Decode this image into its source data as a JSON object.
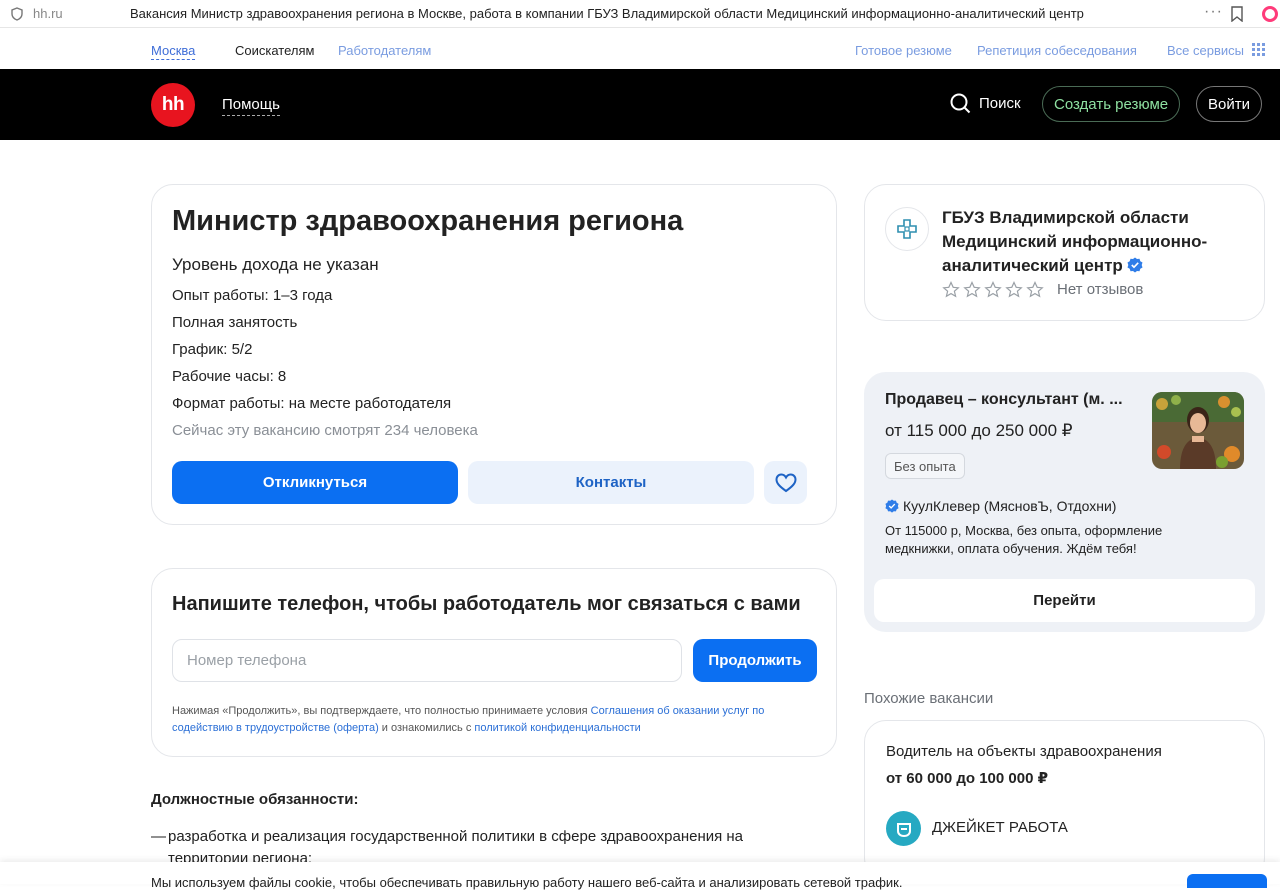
{
  "browser": {
    "url": "hh.ru",
    "tab_title": "Вакансия Министр здравоохранения региона в Москве, работа в компании ГБУЗ Владимирской области Медицинский информационно-аналитический центр"
  },
  "subnav": {
    "city": "Москва",
    "seekers": "Соискателям",
    "employers": "Работодателям",
    "ready_resume": "Готовое резюме",
    "interview_rehearsal": "Репетиция собеседования",
    "all_services": "Все сервисы"
  },
  "header": {
    "logo": "hh",
    "help": "Помощь",
    "search": "Поиск",
    "create_resume": "Создать резюме",
    "login": "Войти"
  },
  "vacancy": {
    "title": "Министр здравоохранения региона",
    "salary": "Уровень дохода не указан",
    "experience": "Опыт работы: 1–3 года",
    "employment": "Полная занятость",
    "schedule": "График: 5/2",
    "hours": "Рабочие часы: 8",
    "format": "Формат работы: на месте работодателя",
    "viewing_now": "Сейчас эту вакансию смотрят 234 человека",
    "apply": "Откликнуться",
    "contacts": "Контакты"
  },
  "phone_form": {
    "title": "Напишите телефон, чтобы работодатель мог связаться с вами",
    "placeholder": "Номер телефона",
    "continue": "Продолжить",
    "terms_prefix": "Нажимая «Продолжить», вы подтверждаете, что полностью принимаете условия ",
    "terms_link1": "Соглашения об оказании услуг по содействию в трудоустройстве (оферта)",
    "terms_middle": " и ознакомились с ",
    "terms_link2": "политикой конфиденциальности"
  },
  "duties": {
    "title": "Должностные обязанности:",
    "items": [
      "разработка и реализация государственной политики в сфере здравоохранения на территории региона;"
    ]
  },
  "company": {
    "name": "ГБУЗ Владимирской области Медицинский информационно-аналитический центр",
    "reviews": "Нет отзывов",
    "rating_stars": 0
  },
  "ad": {
    "title": "Продавец – консультант (м. ...",
    "salary": "от 115 000  до 250 000 ₽",
    "badge": "Без опыта",
    "company": "КуулКлевер (МясновЪ, Отдохни)",
    "description": "От 115000 р, Москва, без опыта, оформление медкнижки, оплата обучения. Ждём тебя!",
    "go": "Перейти"
  },
  "similar": {
    "heading": "Похожие вакансии",
    "items": [
      {
        "title": "Водитель на объекты здравоохранения",
        "salary": "от 60 000 до 100 000 ₽",
        "company": "ДЖЕЙКЕТ РАБОТА"
      }
    ]
  },
  "cookie": {
    "text": "Мы используем файлы cookie, чтобы обеспечивать правильную работу нашего веб-сайта и анализировать сетевой трафик."
  },
  "colors": {
    "brand_red": "#e8141f",
    "primary_blue": "#0b6ff2",
    "header_black": "#000000",
    "create_green": "#8ee0a1"
  }
}
